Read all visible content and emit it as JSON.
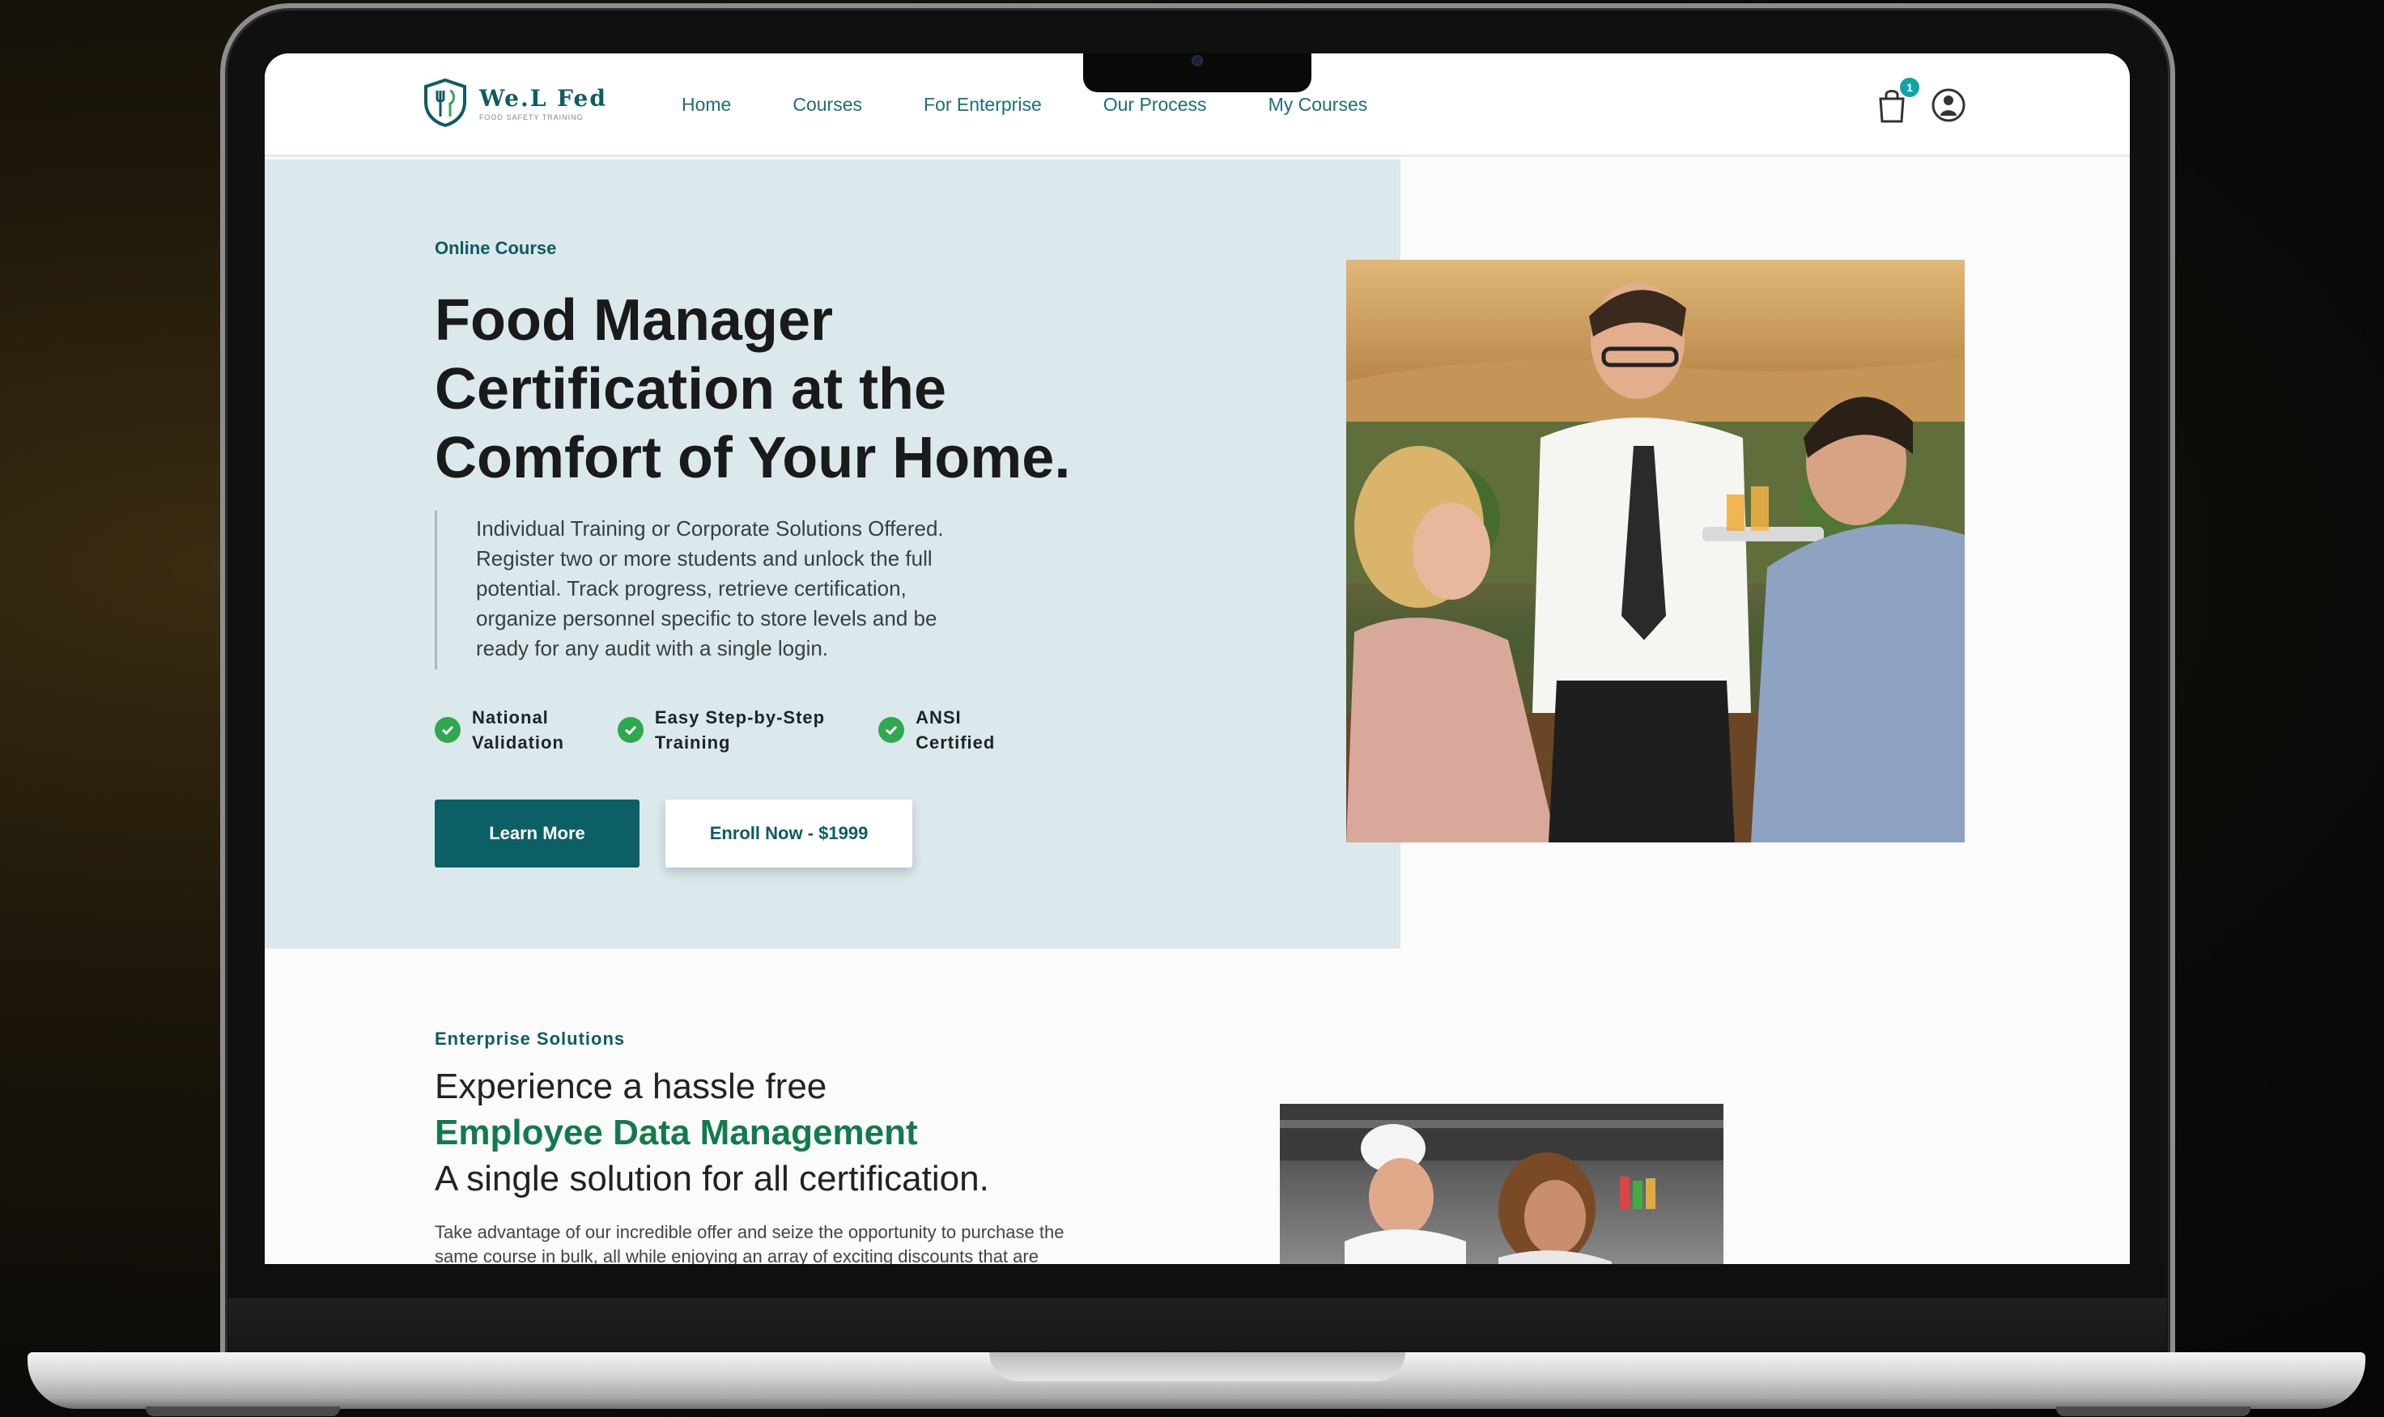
{
  "nav": {
    "logo_name": "We.L Fed",
    "logo_tagline": "FOOD SAFETY TRAINING",
    "links": [
      "Home",
      "Courses",
      "For Enterprise",
      "Our Process",
      "My Courses"
    ],
    "cart_count": "1"
  },
  "hero": {
    "eyebrow": "Online Course",
    "title_line1": "Food Manager",
    "title_line2": "Certification at the",
    "title_line3": "Comfort of Your Home.",
    "description_lines": [
      "Individual Training or Corporate Solutions Offered.",
      "Register two or more students and unlock the full",
      "potential. Track progress, retrieve certification,",
      "organize personnel specific to store levels and be",
      "ready for any audit with a single login."
    ],
    "features": [
      "National\nValidation",
      "Easy Step-by-Step\nTraining",
      "ANSI\nCertified"
    ],
    "learn_more": "Learn More",
    "enroll": "Enroll Now - $1999"
  },
  "enterprise": {
    "eyebrow": "Enterprise Solutions",
    "line1": "Experience a hassle free",
    "line2": "Employee Data Management",
    "line3": "A single solution for all certification.",
    "body_line1": "Take advantage of our incredible offer and seize the opportunity to purchase the",
    "body_line2": "same course in bulk, all while enjoying an array of exciting discounts that are"
  },
  "colors": {
    "brand": "#0d5f66",
    "hero_bg": "#dbe8ec",
    "accent_green": "#127a4c",
    "check_green": "#2fa84f"
  }
}
